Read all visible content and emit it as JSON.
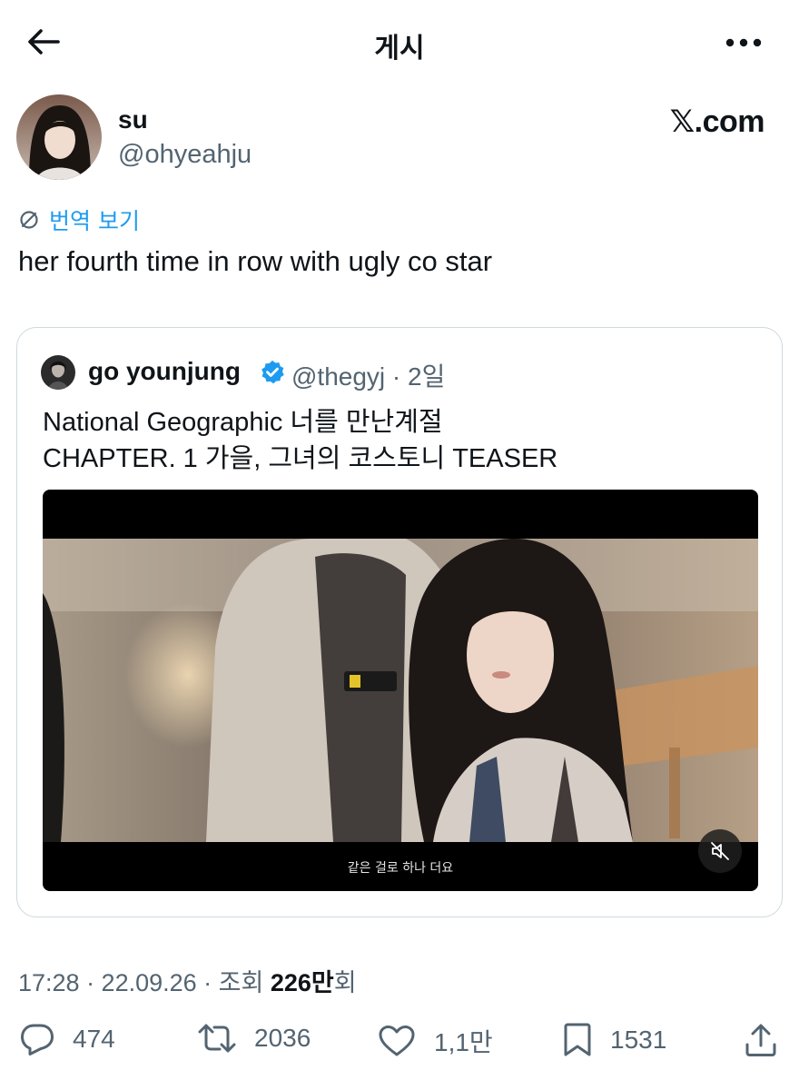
{
  "header": {
    "title": "게시"
  },
  "author": {
    "name": "su",
    "handle": "@ohyeahju"
  },
  "brand": "𝕏.com",
  "translate_label": "번역 보기",
  "tweet_text": "her fourth time in row with ugly co star",
  "quoted": {
    "name": "go younjung",
    "handle_time": "@thegyj · 2일",
    "line1": "National Geographic 너를 만난계절",
    "line2": "CHAPTER. 1 가을, 그녀의 코스토니 TEASER",
    "subtitle": "같은 걸로 하나 더요"
  },
  "meta": {
    "time_date": "17:28 · 22.09.26 · 조회 ",
    "views": "226만",
    "views_suffix": "회"
  },
  "actions": {
    "replies": "474",
    "reposts": "2036",
    "likes": "1,1만",
    "bookmarks": "1531"
  },
  "colors": {
    "accent": "#1d9bf0",
    "secondary_text": "#536471",
    "border": "#cfd9de"
  },
  "icons": [
    "back-arrow-icon",
    "more-icon",
    "translate-icon",
    "verified-icon",
    "mute-icon",
    "reply-icon",
    "repost-icon",
    "like-icon",
    "bookmark-icon",
    "share-icon"
  ]
}
